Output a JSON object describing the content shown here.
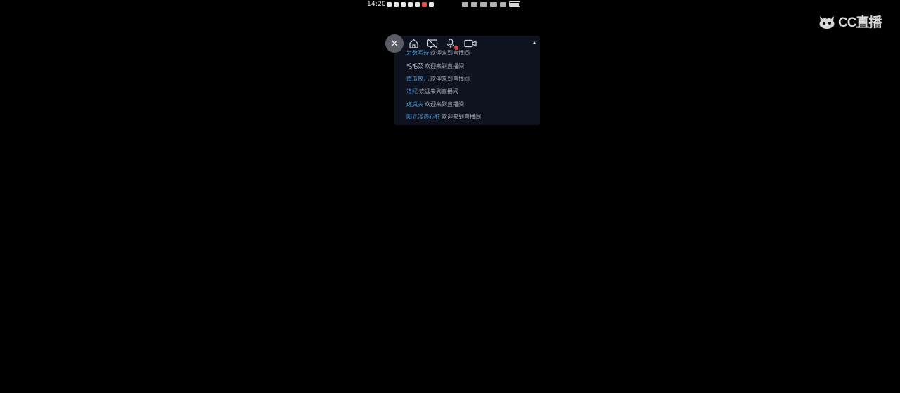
{
  "status_bar": {
    "time": "14:20",
    "notification_icons": [
      "app-icon",
      "mail-icon",
      "news-icon",
      "chat-icon",
      "message-icon",
      "record-icon",
      "gallery-icon"
    ],
    "system_icons": [
      "hd-icon",
      "volte-icon",
      "signal-icon",
      "signal-icon",
      "wifi-icon",
      "battery-icon"
    ]
  },
  "logo": {
    "text": "CC直播"
  },
  "panel": {
    "close_glyph": "✕",
    "toolbar": [
      {
        "name": "home-icon"
      },
      {
        "name": "danmaku-off-icon"
      },
      {
        "name": "mic-icon"
      },
      {
        "name": "camera-icon"
      }
    ],
    "messages": [
      {
        "user": "为数写诗",
        "text": "欢迎来到直播间",
        "highlight": true
      },
      {
        "user": "毛毛菜",
        "text": "欢迎来到直播间",
        "highlight": false
      },
      {
        "user": "南瓜放儿",
        "text": "欢迎来到直播间",
        "highlight": true
      },
      {
        "user": "道纪",
        "text": "欢迎来到直播间",
        "highlight": true
      },
      {
        "user": "逸岚夫",
        "text": "欢迎来到直播间",
        "highlight": true
      },
      {
        "user": "阳光淡透心脏",
        "text": "欢迎来到直播间",
        "highlight": true
      }
    ]
  },
  "colors": {
    "background": "#000000",
    "panel": "#0f1320",
    "username": "#4f9ed8",
    "message": "#a7abb4",
    "badge": "#e04545"
  }
}
